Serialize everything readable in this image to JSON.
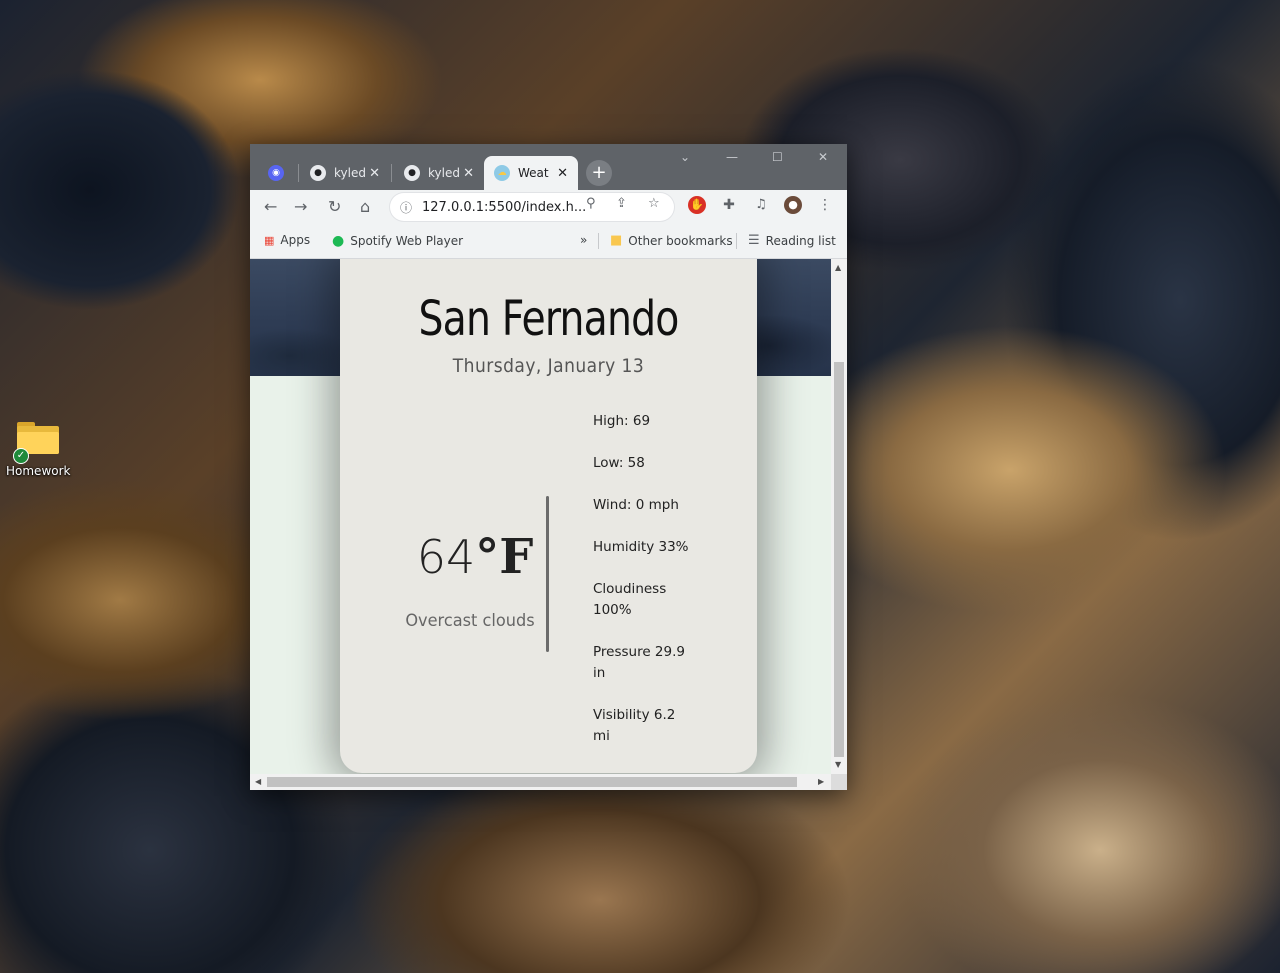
{
  "desktop": {
    "icon_label": "Homework"
  },
  "browser": {
    "tabs": [
      {
        "label": "",
        "icon": "discord-icon"
      },
      {
        "label": "kyled",
        "icon": "github-icon"
      },
      {
        "label": "kyled",
        "icon": "github-icon"
      },
      {
        "label": "Weat",
        "icon": "weather-icon"
      }
    ],
    "url": "127.0.0.1:5500/index.h...",
    "bookmarks": {
      "apps": "Apps",
      "spotify": "Spotify Web Player",
      "more": "»",
      "other": "Other bookmarks",
      "reading": "Reading list"
    }
  },
  "weather": {
    "city": "San Fernando",
    "date": "Thursday, January 13",
    "temp_value": "64",
    "temp_unit": "°F",
    "description": "Overcast clouds",
    "stats": [
      "High: 69",
      "Low: 58",
      "Wind: 0 mph",
      "Humidity 33%",
      "Cloudiness 100%",
      "Pressure 29.9 in",
      "Visibility 6.2 mi"
    ]
  },
  "colors": {
    "accent": "#5f6368",
    "card": "#e9e8e3",
    "page_bg": "#e9f2ea"
  }
}
